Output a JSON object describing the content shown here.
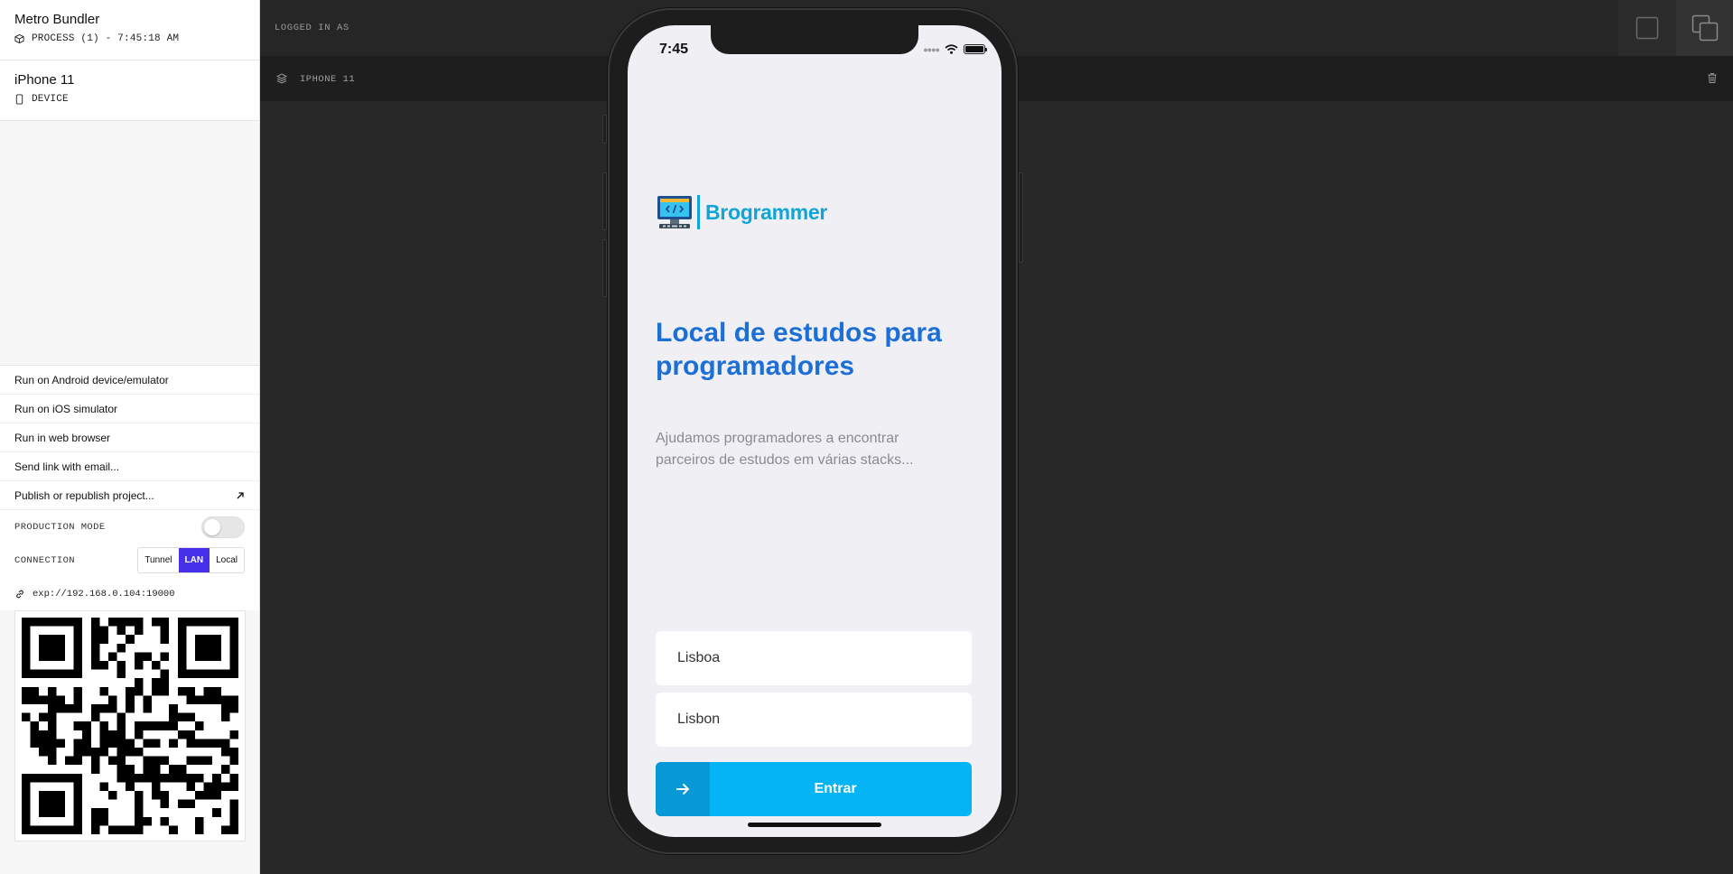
{
  "sidebar": {
    "process": {
      "title": "Metro Bundler",
      "subtitle": "PROCESS (1) - 7:45:18 AM",
      "icon": "package-icon"
    },
    "device": {
      "title": "iPhone 11",
      "subtitle": "DEVICE",
      "icon": "phone-icon"
    },
    "menu": [
      {
        "label": "Run on Android device/emulator"
      },
      {
        "label": "Run on iOS simulator"
      },
      {
        "label": "Run in web browser"
      },
      {
        "label": "Send link with email..."
      },
      {
        "label": "Publish or republish project...",
        "icon": "external-arrow-icon"
      }
    ],
    "production_mode": {
      "label": "PRODUCTION MODE",
      "enabled": false
    },
    "connection": {
      "label": "CONNECTION",
      "options": [
        "Tunnel",
        "LAN",
        "Local"
      ],
      "selected": "LAN",
      "accent": "#4630eb"
    },
    "url": "exp://192.168.0.104:19000"
  },
  "topbar": {
    "logged_in_label": "LOGGED IN AS"
  },
  "devicebar": {
    "label": "IPHONE 11"
  },
  "phone": {
    "time": "7:45",
    "brand": "Brogrammer",
    "brand_color": "#0ea5d8",
    "headline": "Local de estudos para programadores",
    "headline_color": "#1c6fd6",
    "description": "Ajudamos programadores a encontrar parceiros de estudos em várias stacks...",
    "input_1_value": "Lisboa",
    "input_2_value": "Lisbon",
    "button_label": "Entrar",
    "button_color": "#04b4f4"
  }
}
